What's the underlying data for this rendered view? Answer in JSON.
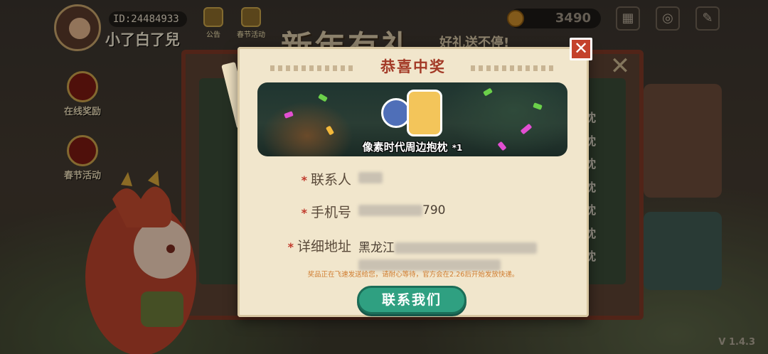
{
  "header": {
    "user_id": "ID:24484933",
    "username": "小了白了兒",
    "top_icons": [
      "公告",
      "春节活动"
    ],
    "coins": "3490"
  },
  "side_menu": {
    "online_reward": "在线奖励",
    "spring_festival": "春节活动"
  },
  "background": {
    "banner_title": "新年有礼",
    "banner_subtitle": "好礼送不停!",
    "pillow_labels": [
      "枕",
      "枕",
      "枕",
      "枕",
      "枕",
      "枕",
      "枕"
    ]
  },
  "modal": {
    "title": "恭喜中奖",
    "prize": {
      "name": "像素时代周边抱枕",
      "quantity": "*1"
    },
    "fields": {
      "contact_label": "联系人",
      "phone_label": "手机号",
      "phone_value_visible": "790",
      "address_label": "详细地址",
      "address_value_visible": "黑龙江",
      "required_mark": "*"
    },
    "notice": "奖品正在飞速发送给您，请耐心等待，官方会在2.26后开始发放快递。",
    "contact_button": "联系我们",
    "close_symbol": "✕"
  },
  "footer": {
    "version": "V 1.4.3"
  },
  "colors": {
    "title_red": "#a33a27",
    "close_red": "#c4412c",
    "button_green": "#2fa081",
    "notice_orange": "#d07c2f",
    "paper": "#f1e6cc"
  }
}
